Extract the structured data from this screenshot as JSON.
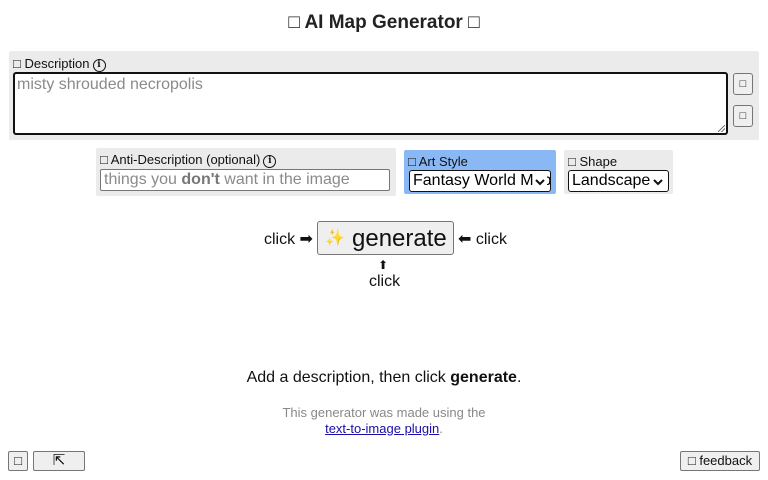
{
  "header": {
    "title": "□ AI Map Generator □"
  },
  "description": {
    "label": "□ Description",
    "info_icon": "ⓘ",
    "placeholder": "misty shrouded necropolis",
    "side_buttons": [
      "□",
      "□"
    ]
  },
  "anti_description": {
    "label": "□ Anti-Description (optional)",
    "info_icon": "ⓘ",
    "placeholder_prefix": "things you ",
    "placeholder_emphasis": "don't",
    "placeholder_suffix": " want in the image"
  },
  "art_style": {
    "label": "□ Art Style",
    "selected": "Fantasy World Map",
    "highlight_color": "#8ab8f5"
  },
  "shape": {
    "label": "□ Shape",
    "selected": "Landscape"
  },
  "generate": {
    "left_hint": "click ➡",
    "right_hint": "⬅ click",
    "below_arrow": "⬆",
    "below_hint": "click",
    "stars_icon": "✨",
    "label": "generate"
  },
  "status": {
    "prefix": "Add a description, then click ",
    "emphasis": "generate",
    "suffix": "."
  },
  "footer": {
    "note": "This generator was made using the",
    "link_text": "text-to-image plugin",
    "link_suffix": "."
  },
  "corner": {
    "left_button": "□",
    "expand_button": "⇱",
    "feedback_button": "□ feedback"
  }
}
